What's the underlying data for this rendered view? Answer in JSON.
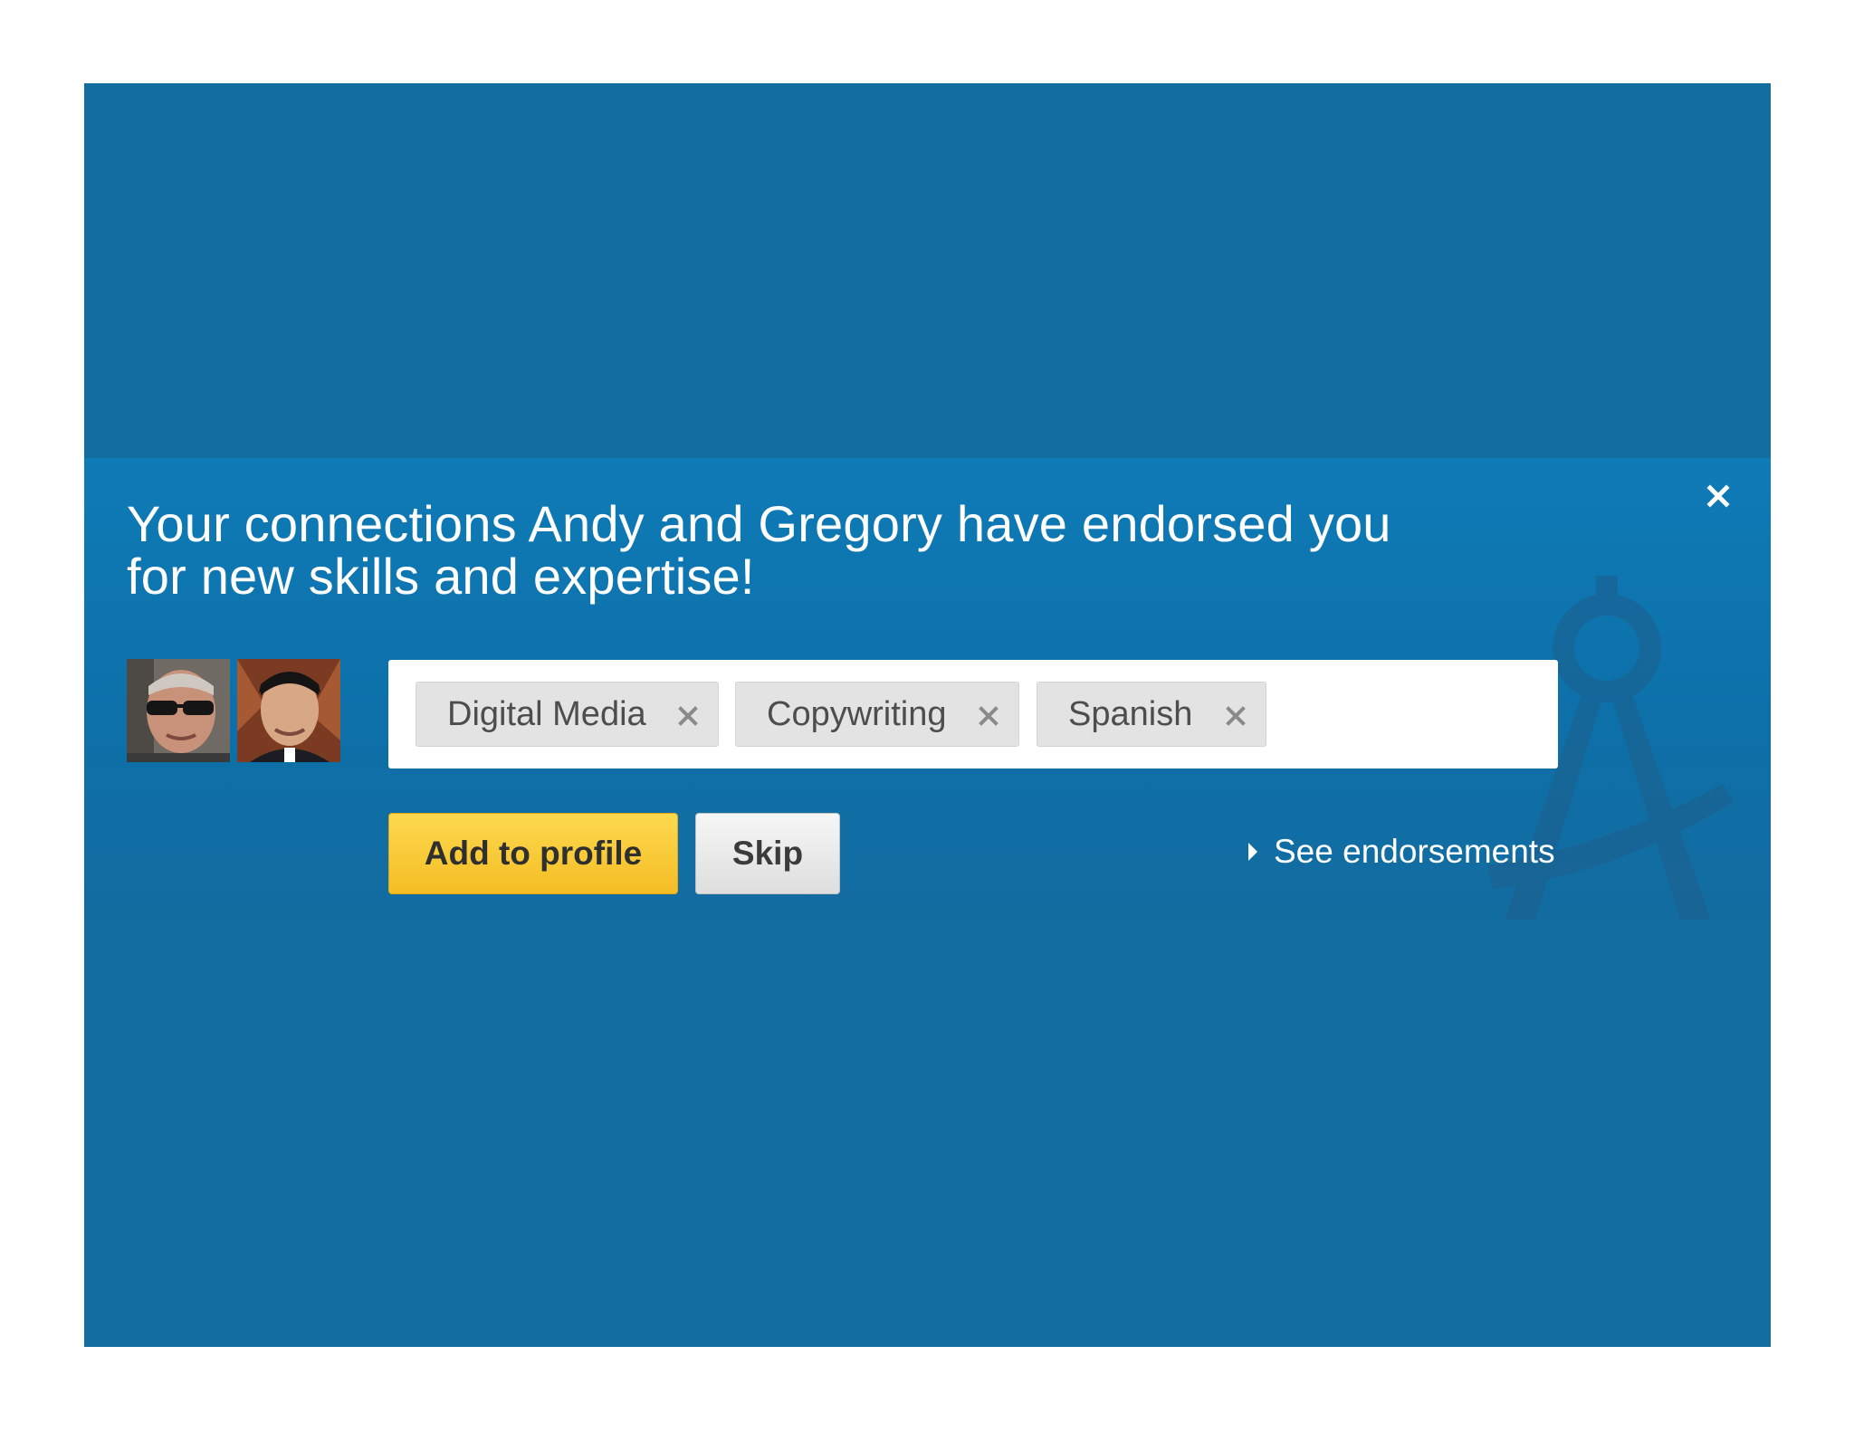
{
  "banner": {
    "headline_line1": "Your connections Andy and Gregory have endorsed you",
    "headline_line2": "for new skills and expertise!",
    "close_icon": "close-icon",
    "background_color": "#0d74ae",
    "accent_color": "#f8c733"
  },
  "endorsers": [
    {
      "avatar": "avatar-photo"
    },
    {
      "avatar": "avatar-photo"
    }
  ],
  "skills": [
    {
      "label": "Digital Media",
      "remove_icon": "close-icon"
    },
    {
      "label": "Copywriting",
      "remove_icon": "close-icon"
    },
    {
      "label": "Spanish",
      "remove_icon": "close-icon"
    }
  ],
  "actions": {
    "add_label": "Add to profile",
    "skip_label": "Skip",
    "see_label": "See endorsements",
    "see_icon": "caret-right-icon"
  }
}
